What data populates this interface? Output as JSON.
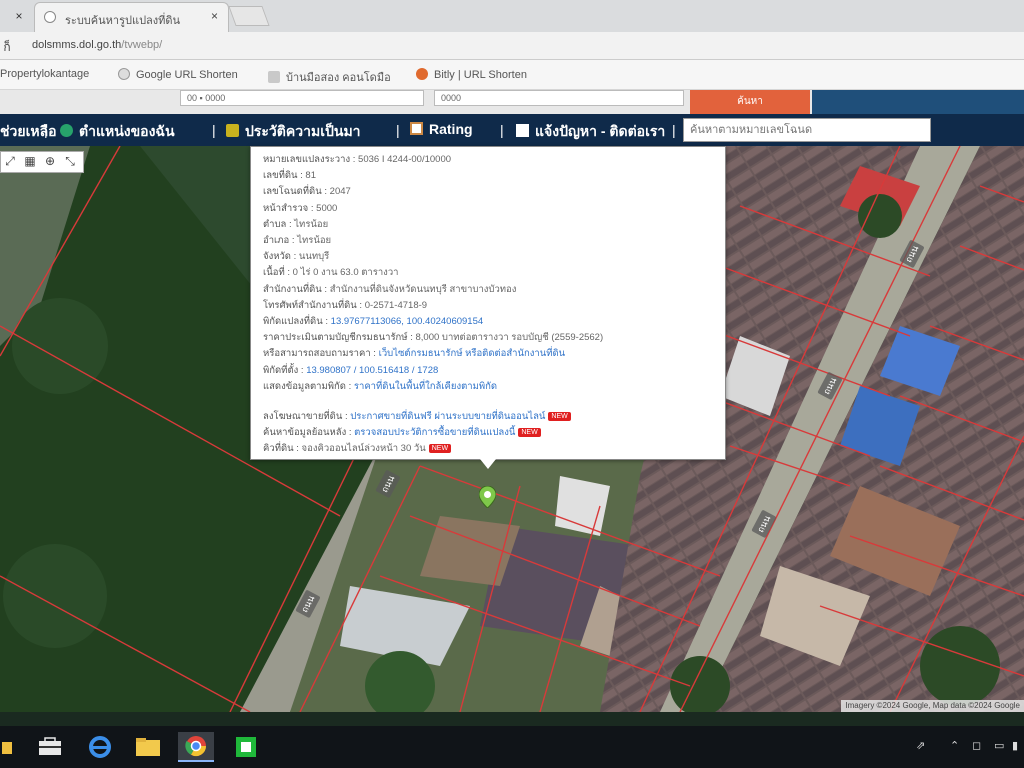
{
  "browser": {
    "tab_title": "ระบบค้นหารูปแปลงที่ดิน",
    "tab_close": "×",
    "nav_left_close": "×",
    "address_nav": "ก็",
    "url_host": "dolsmms.dol.go.th",
    "url_path": "/tvwebp/",
    "bookmarks": [
      {
        "label": "Propertylokantage",
        "icon": "bookmark-icon"
      },
      {
        "label": "Google URL Shorten",
        "icon": "google-icon"
      },
      {
        "label": "บ้านมือสอง คอนโดมือ",
        "icon": "house-icon"
      },
      {
        "label": "Bitly | URL Shorten",
        "icon": "bitly-icon"
      }
    ]
  },
  "site_top": {
    "box1": "00 ▪ 0000",
    "box2": "0000",
    "orange_label": "ค้นหา"
  },
  "navbar": {
    "items": [
      {
        "label": "ช่วยเหลือ",
        "icon": ""
      },
      {
        "label": "ตำแหน่งของฉัน",
        "icon": "location-icon"
      },
      {
        "label": "ประวัติความเป็นมา",
        "icon": "history-icon"
      },
      {
        "label": "Rating",
        "icon": "rating-icon"
      },
      {
        "label": "แจ้งปัญหา - ติดต่อเรา",
        "icon": "contact-icon"
      }
    ],
    "separator": "|",
    "search_placeholder": "ค้นหาตามหมายเลขโฉนด"
  },
  "map": {
    "tools": [
      "⤢",
      "▦",
      "⊕",
      "⤡"
    ],
    "road_labels": [
      "ถนน",
      "ถนน",
      "ถนน",
      "ถนน",
      "ถนน"
    ],
    "attribution": "Imagery ©2024 Google, Map data ©2024 Google"
  },
  "popup": {
    "rows": [
      {
        "label": "หมายเลขแปลงระวาง",
        "value": "5036 I 4244-00/10000"
      },
      {
        "label": "เลขที่ดิน",
        "value": "81"
      },
      {
        "label": "เลขโฉนดที่ดิน",
        "value": "2047"
      },
      {
        "label": "หน้าสำรวจ",
        "value": "5000"
      },
      {
        "label": "ตำบล",
        "value": "ไทรน้อย"
      },
      {
        "label": "อำเภอ",
        "value": "ไทรน้อย"
      },
      {
        "label": "จังหวัด",
        "value": "นนทบุรี"
      },
      {
        "label": "เนื้อที่",
        "value": "0 ไร่ 0 งาน 63.0 ตารางวา"
      },
      {
        "label": "สำนักงานที่ดิน",
        "value": "สำนักงานที่ดินจังหวัดนนทบุรี สาขาบางบัวทอง"
      },
      {
        "label": "โทรศัพท์สำนักงานที่ดิน",
        "value": "0-2571-4718-9"
      },
      {
        "label": "พิกัดแปลงที่ดิน",
        "value": "13.97677113066, 100.40240609154"
      },
      {
        "label": "ราคาประเมินตามบัญชีกรมธนารักษ์",
        "value": "8,000 บาทต่อตารางวา รอบบัญชี (2559-2562)"
      },
      {
        "label": "หรือสามารถสอบถามราคา",
        "value": "เว็บไซต์กรมธนารักษ์ หรือติดต่อสำนักงานที่ดิน"
      },
      {
        "label": "พิกัดที่ตั้ง",
        "value": "13.980807 / 100.516418 / 1728"
      },
      {
        "label": "แสดงข้อมูลตามพิกัด",
        "value": "ราคาที่ดินในพื้นที่ใกล้เคียงตามพิกัด"
      }
    ],
    "extra_rows": [
      {
        "label": "ลงโฆษณาขายที่ดิน",
        "value": "ประกาศขายที่ดินฟรี ผ่านระบบขายที่ดินออนไลน์",
        "badge": "NEW"
      },
      {
        "label": "ค้นหาข้อมูลย้อนหลัง",
        "value": "ตรวจสอบประวัติการซื้อขายที่ดินแปลงนี้",
        "badge": "NEW"
      },
      {
        "label": "คิวที่ดิน",
        "value": "จองคิวออนไลน์ล่วงหน้า 30 วัน",
        "badge": "NEW"
      }
    ]
  },
  "taskbar": {
    "tray_time": "",
    "tray_icons": [
      "network-icon",
      "volume-icon",
      "battery-icon",
      "keyboard-icon"
    ]
  }
}
